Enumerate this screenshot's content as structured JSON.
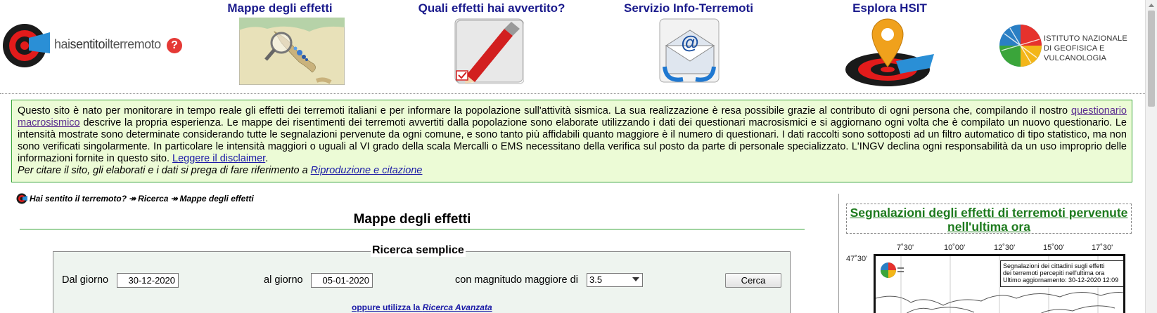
{
  "header": {
    "logo": {
      "text_pre": "hai",
      "text_bold": "sentito",
      "text_mid": "il",
      "text_post": "terremoto",
      "badge": "?"
    },
    "nav": [
      {
        "label": "Mappe degli effetti",
        "icon": "italy-map-magnifier-icon"
      },
      {
        "label": "Quali effetti hai avvertito?",
        "icon": "pen-checkbox-icon"
      },
      {
        "label": "Servizio Info-Terremoti",
        "icon": "email-envelope-icon"
      },
      {
        "label": "Esplora HSIT",
        "icon": "map-pin-target-icon"
      }
    ],
    "ingv": {
      "line1": "ISTITUTO NAZIONALE",
      "line2": "DI GEOFISICA E VULCANOLOGIA"
    }
  },
  "intro": {
    "p1": "Questo sito è nato per monitorare in tempo reale gli effetti dei terremoti italiani e per informare la popolazione sull'attività sismica. La sua realizzazione è resa possibile grazie al contributo di ogni persona che, compilando il nostro ",
    "link1": "questionario macrosismico",
    "p2": " descrive la propria esperienza. Le mappe dei risentimenti dei terremoti avvertiti dalla popolazione sono elaborate utilizzando i dati dei questionari macrosismici e si aggiornano ogni volta che è compilato un nuovo questionario. Le intensità mostrate sono determinate considerando tutte le segnalazioni pervenute da ogni comune, e sono tanto più affidabili quanto maggiore è il numero di questionari. I dati raccolti sono sottoposti ad un filtro automatico di tipo statistico, ma non sono verificati singolarmente. In particolare le intensità maggiori o uguali al VI grado della scala Mercalli o EMS necessitano della verifica sul posto da parte di personale specializzato. L'INGV declina ogni responsabilità da un uso improprio delle informazioni fornite in questo sito. ",
    "link2": "Leggere il disclaimer",
    "p3": ".",
    "cite_text": "Per citare il sito, gli elaborati e i dati si prega di fare riferimento a ",
    "cite_link": "Riproduzione e citazione"
  },
  "breadcrumb": {
    "items": [
      "Hai sentito il terremoto?",
      "Ricerca",
      "Mappe degli effetti"
    ],
    "separator": "↠"
  },
  "main": {
    "title": "Mappe degli effetti"
  },
  "search": {
    "legend": "Ricerca semplice",
    "from_label": "Dal giorno",
    "from_value": "30-12-2020",
    "to_label": "al giorno",
    "to_value": "05-01-2020",
    "mag_label": "con magnitudo maggiore di",
    "mag_value": "3.5",
    "button": "Cerca",
    "advanced_pre": "oppure utilizza la ",
    "advanced_link": "Ricerca Avanzata"
  },
  "side": {
    "title": "Segnalazioni degli effetti di terremoti pervenute nell'ultima ora",
    "map": {
      "lon_ticks": [
        "7˚30'",
        "10˚00'",
        "12˚30'",
        "15˚00'",
        "17˚30'"
      ],
      "lat_ticks": [
        "47˚30'"
      ],
      "legend_line1": "Segnalazioni dei cittadini sugli effetti",
      "legend_line2": "dei terremoti percepiti nell'ultima ora",
      "legend_line3": "Ultimo aggiornamento: 30-12-2020 12:09"
    }
  }
}
